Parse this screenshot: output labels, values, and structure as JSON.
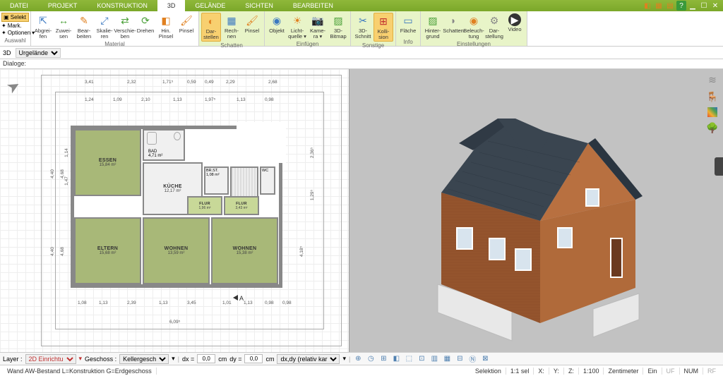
{
  "menu": {
    "tabs": [
      "DATEI",
      "PROJEKT",
      "KONSTRUKTION",
      "3D",
      "GELÄNDE",
      "SICHTEN",
      "BEARBEITEN"
    ],
    "active": 3
  },
  "ribbon": {
    "sel": {
      "selekt": "Selekt",
      "mark": "Mark.",
      "optionen": "Optionen",
      "group": "Auswahl"
    },
    "material": {
      "tools": [
        {
          "icon": "⇱",
          "l1": "Abgrei-",
          "l2": "fen"
        },
        {
          "icon": "↔",
          "l1": "Zuwei-",
          "l2": "sen"
        },
        {
          "icon": "✎",
          "l1": "Bear-",
          "l2": "beiten"
        },
        {
          "icon": "⤢",
          "l1": "Skalie-",
          "l2": "ren"
        },
        {
          "icon": "⇄",
          "l1": "Verschie-",
          "l2": "ben"
        },
        {
          "icon": "⟳",
          "l1": "Drehen",
          "l2": ""
        },
        {
          "icon": "◧",
          "l1": "Hin.",
          "l2": "Pinsel"
        },
        {
          "icon": "🖌",
          "l1": "Pinsel",
          "l2": ""
        }
      ],
      "label": "Material"
    },
    "schatten": {
      "tools": [
        {
          "icon": "◐",
          "l1": "Dar-",
          "l2": "stellen",
          "active": true
        },
        {
          "icon": "▦",
          "l1": "Rech-",
          "l2": "nen"
        },
        {
          "icon": "🖌",
          "l1": "Pinsel",
          "l2": ""
        }
      ],
      "label": "Schatten"
    },
    "einfuegen": {
      "tools": [
        {
          "icon": "◉",
          "l1": "Objekt",
          "l2": ""
        },
        {
          "icon": "☀",
          "l1": "Licht-",
          "l2": "quelle ▾"
        },
        {
          "icon": "📷",
          "l1": "Kame-",
          "l2": "ra ▾"
        },
        {
          "icon": "▨",
          "l1": "3D-",
          "l2": "Bitmap"
        }
      ],
      "label": "Einfügen"
    },
    "sonstige": {
      "tools": [
        {
          "icon": "✂",
          "l1": "3D-",
          "l2": "Schnitt"
        },
        {
          "icon": "⊞",
          "l1": "Kolli-",
          "l2": "sion",
          "active": true
        }
      ],
      "label": "Sonstige"
    },
    "info": {
      "tools": [
        {
          "icon": "▭",
          "l1": "Fläche",
          "l2": ""
        }
      ],
      "label": "Info"
    },
    "einstellungen": {
      "tools": [
        {
          "icon": "▨",
          "l1": "Hinter-",
          "l2": "grund"
        },
        {
          "icon": "◗",
          "l1": "Schatten",
          "l2": ""
        },
        {
          "icon": "◉",
          "l1": "Beleuch-",
          "l2": "tung"
        },
        {
          "icon": "⚙",
          "l1": "Dar-",
          "l2": "stellung"
        },
        {
          "icon": "▶",
          "l1": "Video",
          "l2": ""
        }
      ],
      "label": "Einstellungen"
    }
  },
  "subbar": {
    "l1": "3D",
    "sel": "Urgelände"
  },
  "dialoge": "Dialoge:",
  "plan": {
    "rooms": {
      "essen": {
        "name": "ESSEN",
        "area": "15,84 m²"
      },
      "eltern": {
        "name": "ELTERN",
        "area": "15,68 m²"
      },
      "wohnen1": {
        "name": "WOHNEN",
        "area": "13,59 m²"
      },
      "wohnen2": {
        "name": "WOHNEN",
        "area": "15,38 m²"
      },
      "kueche": {
        "name": "KÜCHE",
        "area": "12,17 m²"
      },
      "bad": {
        "name": "BAD",
        "area": "4,71 m²"
      },
      "bkst": {
        "name": "BR.ST.",
        "area": "1,08 m²"
      },
      "flur1": {
        "name": "FLUR",
        "area": "1,96 m²"
      },
      "flur2": {
        "name": "FLUR",
        "area": "3,43 m²"
      },
      "wc": {
        "name": "WC",
        "area": ""
      }
    },
    "dims_top": [
      "3,41",
      "2,32",
      "1,71⁵",
      "0,59",
      "0,49",
      "2,29",
      "2,68"
    ],
    "dims_top2": [
      "1,24",
      "1,09",
      "2,10",
      "1,13",
      "1,97⁵",
      "1,13",
      "0,98"
    ],
    "dims_bot": [
      "1,08",
      "1,13",
      "2,39",
      "1,13",
      "3,45",
      "1,01",
      "1,13",
      "0,98",
      "0,98"
    ],
    "dims_bot2": "6,09⁵",
    "dims_left": [
      "4,40",
      "4,68"
    ],
    "dims_left2": [
      "1,14",
      "1,47"
    ],
    "dims_right": [
      "2,36⁵",
      "1,29⁵",
      "4,18⁵"
    ],
    "section": "A"
  },
  "status1": {
    "layer": "Layer :",
    "layer_v": "2D Einrichtu",
    "geschoss": "Geschoss :",
    "geschoss_v": "Kellergesch",
    "dx": "dx =",
    "dy": "dy =",
    "v": "0,0",
    "cm": "cm",
    "mode": "dx,dy (relativ kar"
  },
  "status2": {
    "left": "Wand AW-Bestand L=Konstruktion G=Erdgeschoss",
    "selektion": "Selektion",
    "scale1": "1:1 sel",
    "x": "X:",
    "y": "Y:",
    "z": "Z:",
    "scale2": "1:100",
    "unit": "Zentimeter",
    "ein": "Ein",
    "uf": "UF",
    "num": "NUM",
    "rf": "RF"
  }
}
